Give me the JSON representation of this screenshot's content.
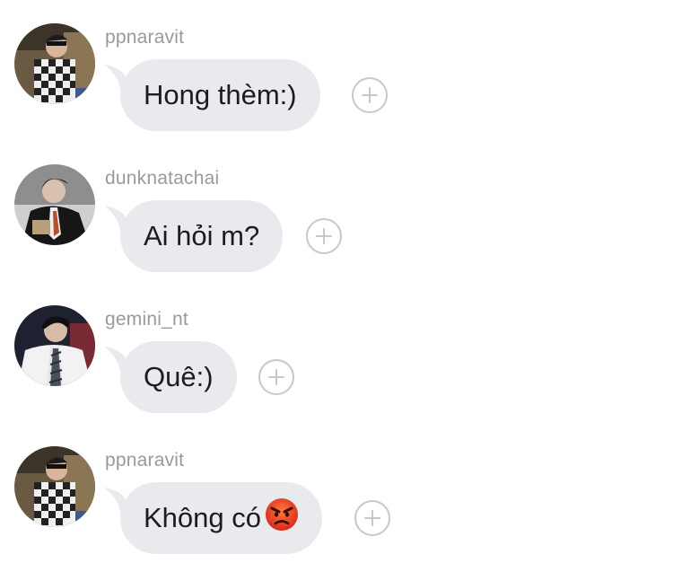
{
  "colors": {
    "bubble": "#e9eaee",
    "username": "#9a9a9e",
    "text": "#1c1c1e",
    "react_outline": "#c7c7cc"
  },
  "messages": [
    {
      "username": "ppnaravit",
      "text": "Hong thèm:)",
      "emoji": "",
      "avatar_icon": "avatar-ppnaravit"
    },
    {
      "username": "dunknatachai",
      "text": "Ai hỏi m?",
      "emoji": "",
      "avatar_icon": "avatar-dunknatachai"
    },
    {
      "username": "gemini_nt",
      "text": "Quê:)",
      "emoji": "",
      "avatar_icon": "avatar-gemini_nt"
    },
    {
      "username": "ppnaravit",
      "text": "Không có",
      "emoji": "angry-face-icon",
      "avatar_icon": "avatar-ppnaravit"
    }
  ]
}
